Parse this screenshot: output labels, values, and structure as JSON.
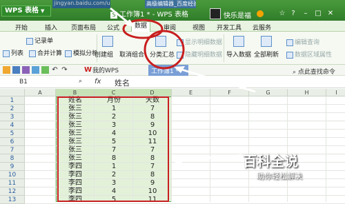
{
  "titlebar": {
    "app_name": "WPS 表格",
    "url_fragment": "jingyan.baidu.com/user/n",
    "tab_fragment": "高级编辑器_百度经验",
    "doc_title": "工作簿1 * - WPS 表格",
    "username": "快乐是福"
  },
  "menubar": {
    "items": [
      "开始",
      "插入",
      "页面布局",
      "公式",
      "数据",
      "审阅",
      "视图",
      "开发工具",
      "云服务"
    ],
    "active": "数据"
  },
  "ribbon": {
    "record_list": "记录单",
    "list": "列表",
    "merge_calc": "合并计算",
    "what_if": "模拟分析",
    "create_group": "创建组",
    "ungroup": "取消组合",
    "subtotal": "分类汇总",
    "show_detail": "显示明细数据",
    "hide_detail": "隐藏明细数据",
    "import_data": "导入数据",
    "refresh_all": "全部刷新",
    "edit_query": "编辑查询",
    "data_area_props": "数据区域属性"
  },
  "toolbar": {
    "tab_mywps": "我的WPS",
    "tab_doc": "工作簿1 *",
    "cmd_search": "点此查找命令"
  },
  "formulabar": {
    "cell_ref": "B1",
    "fx": "fx",
    "content": "姓名"
  },
  "grid": {
    "columns": [
      "A",
      "B",
      "C",
      "D",
      "E",
      "F",
      "G",
      "H",
      "I"
    ],
    "row_numbers": [
      "1",
      "2",
      "3",
      "4",
      "5",
      "6",
      "7",
      "8",
      "9",
      "10",
      "11",
      "12",
      "13"
    ],
    "headers": [
      "姓名",
      "月份",
      "天数"
    ],
    "rows": [
      [
        "张三",
        "1",
        "7"
      ],
      [
        "张三",
        "2",
        "8"
      ],
      [
        "张三",
        "3",
        "9"
      ],
      [
        "张三",
        "4",
        "10"
      ],
      [
        "张三",
        "5",
        "11"
      ],
      [
        "张三",
        "7",
        "7"
      ],
      [
        "张三",
        "8",
        "8"
      ],
      [
        "李四",
        "1",
        "7"
      ],
      [
        "李四",
        "2",
        "8"
      ],
      [
        "李四",
        "3",
        "9"
      ],
      [
        "李四",
        "4",
        "10"
      ],
      [
        "李四",
        "5",
        "11"
      ]
    ]
  },
  "watermark": {
    "title": "百科全说",
    "subtitle": "助你轻松解决"
  },
  "colors": {
    "accent_green": "#2f7d2a",
    "selection_fill": "#e3f1d9",
    "annotation_red": "#c81e1e"
  }
}
